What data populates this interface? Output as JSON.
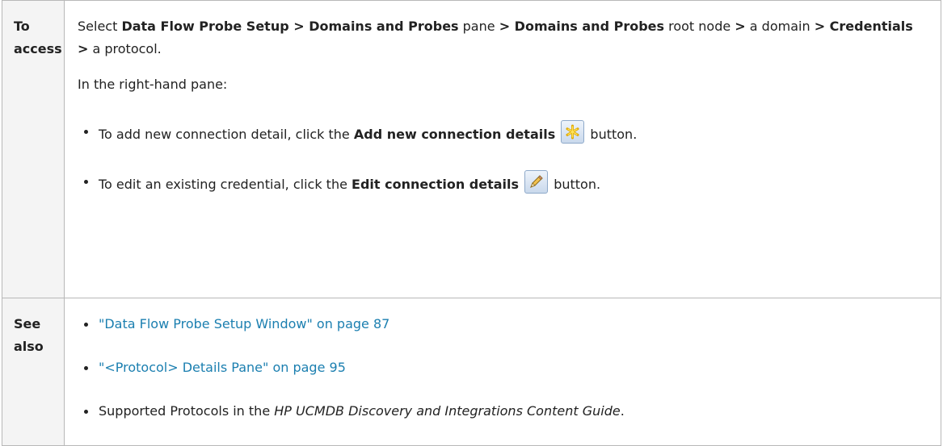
{
  "rows": [
    {
      "label_line1": "To",
      "label_line2": "access",
      "p1": {
        "t1": "Select ",
        "b1": "Data Flow Probe Setup > Domains and Probes",
        "t2": " pane ",
        "b2": "> Domains and Probes",
        "t3": " root node ",
        "b3": ">",
        "t4": " a domain ",
        "b4": "> Credentials >",
        "t5": " a protocol."
      },
      "p2": "In the right-hand pane:",
      "bullets": [
        {
          "pre": "To add new connection detail, click the ",
          "bold": "Add new connection details",
          "post": " button.",
          "icon": "add-star-icon"
        },
        {
          "pre": "To edit an existing credential, click the ",
          "bold": "Edit connection details",
          "post": " button.",
          "icon": "pencil-icon"
        }
      ]
    },
    {
      "label_line1": "See",
      "label_line2": "also",
      "links": [
        "\"Data Flow Probe Setup Window\" on page 87",
        "\"<Protocol> Details Pane\" on page 95"
      ],
      "last": {
        "pre": "Supported Protocols in the ",
        "italic": "HP UCMDB Discovery and Integrations Content Guide",
        "post": "."
      }
    }
  ],
  "colors": {
    "link": "#1b7fb0",
    "label_bg": "#f4f4f4",
    "border": "#b8b8b8"
  }
}
